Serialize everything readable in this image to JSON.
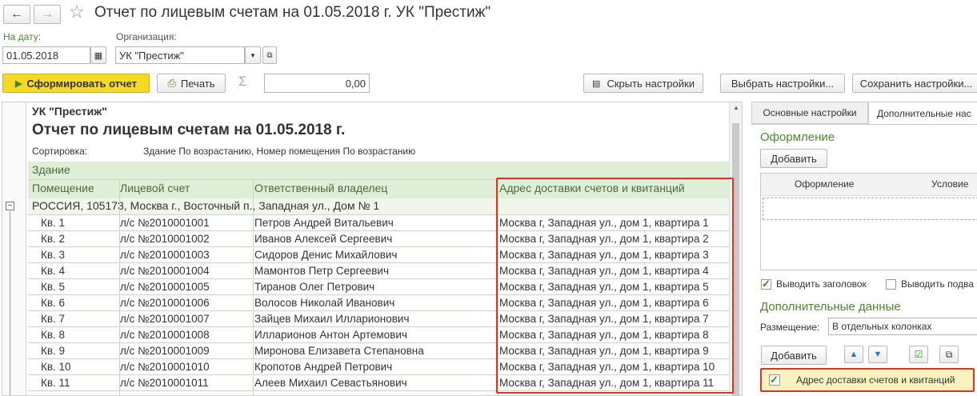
{
  "window": {
    "title": "Отчет по лицевым счетам на 01.05.2018 г. УК \"Престиж\""
  },
  "form": {
    "date_label": "На дату:",
    "date_value": "01.05.2018",
    "org_label": "Организация:",
    "org_value": "УК \"Престиж\""
  },
  "toolbar": {
    "generate": "Сформировать отчет",
    "print": "Печать",
    "sum_value": "0,00",
    "hide_settings": "Скрыть настройки",
    "select_settings": "Выбрать настройки...",
    "save_settings": "Сохранить настройки..."
  },
  "report": {
    "org": "УК \"Престиж\"",
    "title": "Отчет по лицевым счетам на 01.05.2018 г.",
    "sort_label": "Сортировка:",
    "sort_value": "Здание По возрастанию, Номер помещения По возрастанию",
    "group_header": "Здание",
    "columns": [
      "Помещение",
      "Лицевой счет",
      "Ответственный владелец",
      "Адрес доставки счетов и квитанций"
    ],
    "group_row": "РОССИЯ, 105173, Москва г., Восточный п., Западная ул., Дом № 1",
    "rows": [
      [
        "Кв. 1",
        "л/с №2010001001",
        "Петров Андрей Витальевич",
        "Москва г, Западная ул., дом 1, квартира 1"
      ],
      [
        "Кв. 2",
        "л/с №2010001002",
        "Иванов Алексей Сергеевич",
        "Москва г, Западная ул., дом 1, квартира 2"
      ],
      [
        "Кв. 3",
        "л/с №2010001003",
        "Сидоров Денис Михайлович",
        "Москва г, Западная ул., дом 1, квартира 3"
      ],
      [
        "Кв. 4",
        "л/с №2010001004",
        "Мамонтов Петр Сергеевич",
        "Москва г, Западная ул., дом 1, квартира 4"
      ],
      [
        "Кв. 5",
        "л/с №2010001005",
        "Тиранов Олег Петрович",
        "Москва г, Западная ул., дом 1, квартира 5"
      ],
      [
        "Кв. 6",
        "л/с №2010001006",
        "Волосов Николай Иванович",
        "Москва г, Западная ул., дом 1, квартира 6"
      ],
      [
        "Кв. 7",
        "л/с №2010001007",
        "Зайцев Михаил Илларионович",
        "Москва г, Западная ул., дом 1, квартира 7"
      ],
      [
        "Кв. 8",
        "л/с №2010001008",
        "Илларионов Антон Артемович",
        "Москва г, Западная ул., дом 1, квартира 8"
      ],
      [
        "Кв. 9",
        "л/с №2010001009",
        "Миронова Елизавета Степановна",
        "Москва г, Западная ул., дом 1, квартира 9"
      ],
      [
        "Кв. 10",
        "л/с №2010001010",
        "Кропотов Андрей Петрович",
        "Москва г, Западная ул., дом 1, квартира 10"
      ],
      [
        "Кв. 11",
        "л/с №2010001011",
        "Алеев Михаил Севастьянович",
        "Москва г, Западная ул., дом 1, квартира 11"
      ]
    ]
  },
  "settings": {
    "tab_main": "Основные настройки",
    "tab_extra": "Дополнительные нас",
    "design_title": "Оформление",
    "add_button": "Добавить",
    "col_design": "Оформление",
    "col_condition": "Условие",
    "show_header": "Выводить заголовок",
    "show_footer": "Выводить подва",
    "extra_data_title": "Дополнительные данные",
    "placement_label": "Размещение:",
    "placement_value": "В отдельных колонках",
    "add_button2": "Добавить",
    "extra_item": "Адрес доставки счетов и квитанций"
  },
  "colors": {
    "accent_green": "#4d8a2b",
    "highlight_red": "#d9352b",
    "yellow_button": "#f5d923",
    "table_header_bg": "#dfeed7"
  }
}
